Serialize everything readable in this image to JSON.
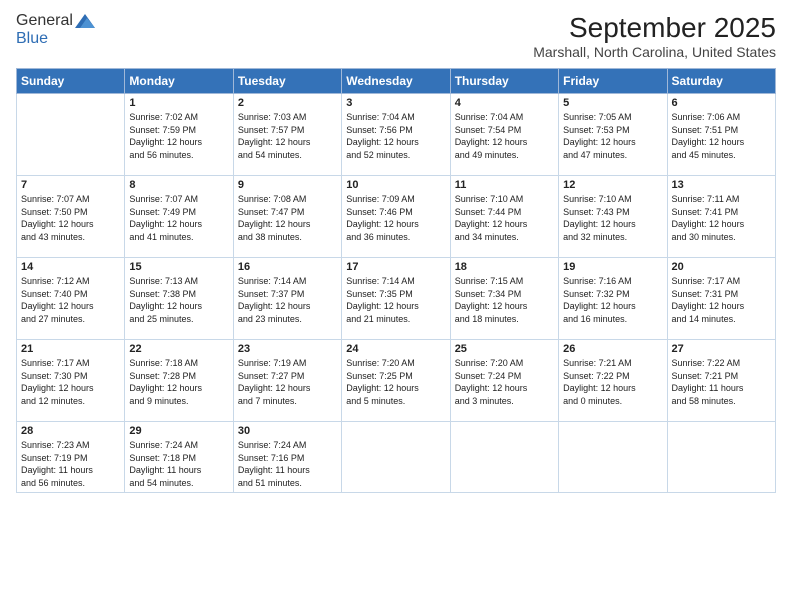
{
  "header": {
    "logo_general": "General",
    "logo_blue": "Blue",
    "month": "September 2025",
    "location": "Marshall, North Carolina, United States"
  },
  "days_of_week": [
    "Sunday",
    "Monday",
    "Tuesday",
    "Wednesday",
    "Thursday",
    "Friday",
    "Saturday"
  ],
  "weeks": [
    [
      {
        "num": "",
        "info": ""
      },
      {
        "num": "1",
        "info": "Sunrise: 7:02 AM\nSunset: 7:59 PM\nDaylight: 12 hours\nand 56 minutes."
      },
      {
        "num": "2",
        "info": "Sunrise: 7:03 AM\nSunset: 7:57 PM\nDaylight: 12 hours\nand 54 minutes."
      },
      {
        "num": "3",
        "info": "Sunrise: 7:04 AM\nSunset: 7:56 PM\nDaylight: 12 hours\nand 52 minutes."
      },
      {
        "num": "4",
        "info": "Sunrise: 7:04 AM\nSunset: 7:54 PM\nDaylight: 12 hours\nand 49 minutes."
      },
      {
        "num": "5",
        "info": "Sunrise: 7:05 AM\nSunset: 7:53 PM\nDaylight: 12 hours\nand 47 minutes."
      },
      {
        "num": "6",
        "info": "Sunrise: 7:06 AM\nSunset: 7:51 PM\nDaylight: 12 hours\nand 45 minutes."
      }
    ],
    [
      {
        "num": "7",
        "info": "Sunrise: 7:07 AM\nSunset: 7:50 PM\nDaylight: 12 hours\nand 43 minutes."
      },
      {
        "num": "8",
        "info": "Sunrise: 7:07 AM\nSunset: 7:49 PM\nDaylight: 12 hours\nand 41 minutes."
      },
      {
        "num": "9",
        "info": "Sunrise: 7:08 AM\nSunset: 7:47 PM\nDaylight: 12 hours\nand 38 minutes."
      },
      {
        "num": "10",
        "info": "Sunrise: 7:09 AM\nSunset: 7:46 PM\nDaylight: 12 hours\nand 36 minutes."
      },
      {
        "num": "11",
        "info": "Sunrise: 7:10 AM\nSunset: 7:44 PM\nDaylight: 12 hours\nand 34 minutes."
      },
      {
        "num": "12",
        "info": "Sunrise: 7:10 AM\nSunset: 7:43 PM\nDaylight: 12 hours\nand 32 minutes."
      },
      {
        "num": "13",
        "info": "Sunrise: 7:11 AM\nSunset: 7:41 PM\nDaylight: 12 hours\nand 30 minutes."
      }
    ],
    [
      {
        "num": "14",
        "info": "Sunrise: 7:12 AM\nSunset: 7:40 PM\nDaylight: 12 hours\nand 27 minutes."
      },
      {
        "num": "15",
        "info": "Sunrise: 7:13 AM\nSunset: 7:38 PM\nDaylight: 12 hours\nand 25 minutes."
      },
      {
        "num": "16",
        "info": "Sunrise: 7:14 AM\nSunset: 7:37 PM\nDaylight: 12 hours\nand 23 minutes."
      },
      {
        "num": "17",
        "info": "Sunrise: 7:14 AM\nSunset: 7:35 PM\nDaylight: 12 hours\nand 21 minutes."
      },
      {
        "num": "18",
        "info": "Sunrise: 7:15 AM\nSunset: 7:34 PM\nDaylight: 12 hours\nand 18 minutes."
      },
      {
        "num": "19",
        "info": "Sunrise: 7:16 AM\nSunset: 7:32 PM\nDaylight: 12 hours\nand 16 minutes."
      },
      {
        "num": "20",
        "info": "Sunrise: 7:17 AM\nSunset: 7:31 PM\nDaylight: 12 hours\nand 14 minutes."
      }
    ],
    [
      {
        "num": "21",
        "info": "Sunrise: 7:17 AM\nSunset: 7:30 PM\nDaylight: 12 hours\nand 12 minutes."
      },
      {
        "num": "22",
        "info": "Sunrise: 7:18 AM\nSunset: 7:28 PM\nDaylight: 12 hours\nand 9 minutes."
      },
      {
        "num": "23",
        "info": "Sunrise: 7:19 AM\nSunset: 7:27 PM\nDaylight: 12 hours\nand 7 minutes."
      },
      {
        "num": "24",
        "info": "Sunrise: 7:20 AM\nSunset: 7:25 PM\nDaylight: 12 hours\nand 5 minutes."
      },
      {
        "num": "25",
        "info": "Sunrise: 7:20 AM\nSunset: 7:24 PM\nDaylight: 12 hours\nand 3 minutes."
      },
      {
        "num": "26",
        "info": "Sunrise: 7:21 AM\nSunset: 7:22 PM\nDaylight: 12 hours\nand 0 minutes."
      },
      {
        "num": "27",
        "info": "Sunrise: 7:22 AM\nSunset: 7:21 PM\nDaylight: 11 hours\nand 58 minutes."
      }
    ],
    [
      {
        "num": "28",
        "info": "Sunrise: 7:23 AM\nSunset: 7:19 PM\nDaylight: 11 hours\nand 56 minutes."
      },
      {
        "num": "29",
        "info": "Sunrise: 7:24 AM\nSunset: 7:18 PM\nDaylight: 11 hours\nand 54 minutes."
      },
      {
        "num": "30",
        "info": "Sunrise: 7:24 AM\nSunset: 7:16 PM\nDaylight: 11 hours\nand 51 minutes."
      },
      {
        "num": "",
        "info": ""
      },
      {
        "num": "",
        "info": ""
      },
      {
        "num": "",
        "info": ""
      },
      {
        "num": "",
        "info": ""
      }
    ]
  ]
}
